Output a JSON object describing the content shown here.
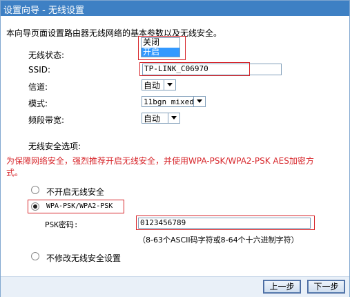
{
  "title": "设置向导 - 无线设置",
  "intro": "本向导页面设置路由器无线网络的基本参数以及无线安全。",
  "fields": {
    "wireless_status_label": "无线状态:",
    "wireless_status_options": [
      "关闭",
      "开启"
    ],
    "wireless_status_selected": "开启",
    "ssid_label": "SSID:",
    "ssid_value": "TP-LINK_C06970",
    "channel_label": "信道:",
    "channel_value": "自动",
    "mode_label": "模式:",
    "mode_value": "11bgn mixed",
    "bandwidth_label": "频段带宽:",
    "bandwidth_value": "自动"
  },
  "security": {
    "heading": "无线安全选项:",
    "warning_line1": "为保障网络安全，强烈推荐开启无线安全，并使用WPA-PSK/WPA2-PSK AES加密方",
    "warning_line2": "式。",
    "option_off": "不开启无线安全",
    "option_wpa": "WPA-PSK/WPA2-PSK",
    "psk_label": "PSK密码:",
    "psk_value": "0123456789",
    "psk_hint": "（8-63个ASCII码字符或8-64个十六进制字符）",
    "option_keep": "不修改无线安全设置",
    "selected": "WPA-PSK/WPA2-PSK"
  },
  "buttons": {
    "prev": "上一步",
    "next": "下一步"
  },
  "colors": {
    "titlebar": "#3e80c4",
    "highlight": "#d7252a",
    "selection": "#3399ff"
  }
}
